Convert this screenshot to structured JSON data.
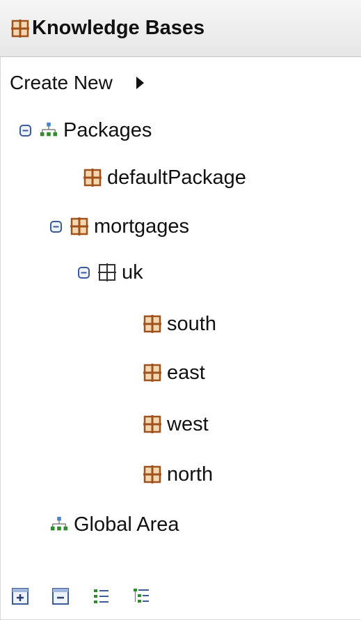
{
  "panel": {
    "title": "Knowledge Bases",
    "icon": "package-icon"
  },
  "create_new": {
    "label": "Create New",
    "icon": "arrow-right-icon"
  },
  "tree": {
    "packages": {
      "label": "Packages",
      "icon": "hierarchy-icon",
      "expanded": true
    },
    "default_package": {
      "label": "defaultPackage",
      "icon": "package-icon"
    },
    "mortgages": {
      "label": "mortgages",
      "icon": "package-icon",
      "expanded": true
    },
    "uk": {
      "label": "uk",
      "icon": "package-outline-icon",
      "expanded": true
    },
    "south": {
      "label": "south",
      "icon": "package-icon"
    },
    "east": {
      "label": "east",
      "icon": "package-icon"
    },
    "west": {
      "label": "west",
      "icon": "package-icon"
    },
    "north": {
      "label": "north",
      "icon": "package-icon"
    },
    "global_area": {
      "label": "Global Area",
      "icon": "hierarchy-icon"
    }
  },
  "toolbar": {
    "buttons": [
      "expand-all-icon",
      "collapse-all-icon",
      "flat-view-icon",
      "hierarchical-view-icon"
    ]
  },
  "colors": {
    "package_fill": "#b5651d",
    "package_outline": "#333333",
    "tree_green": "#2e8b2e",
    "tree_blue": "#4a86c5",
    "toggle_blue": "#3d5a99"
  }
}
